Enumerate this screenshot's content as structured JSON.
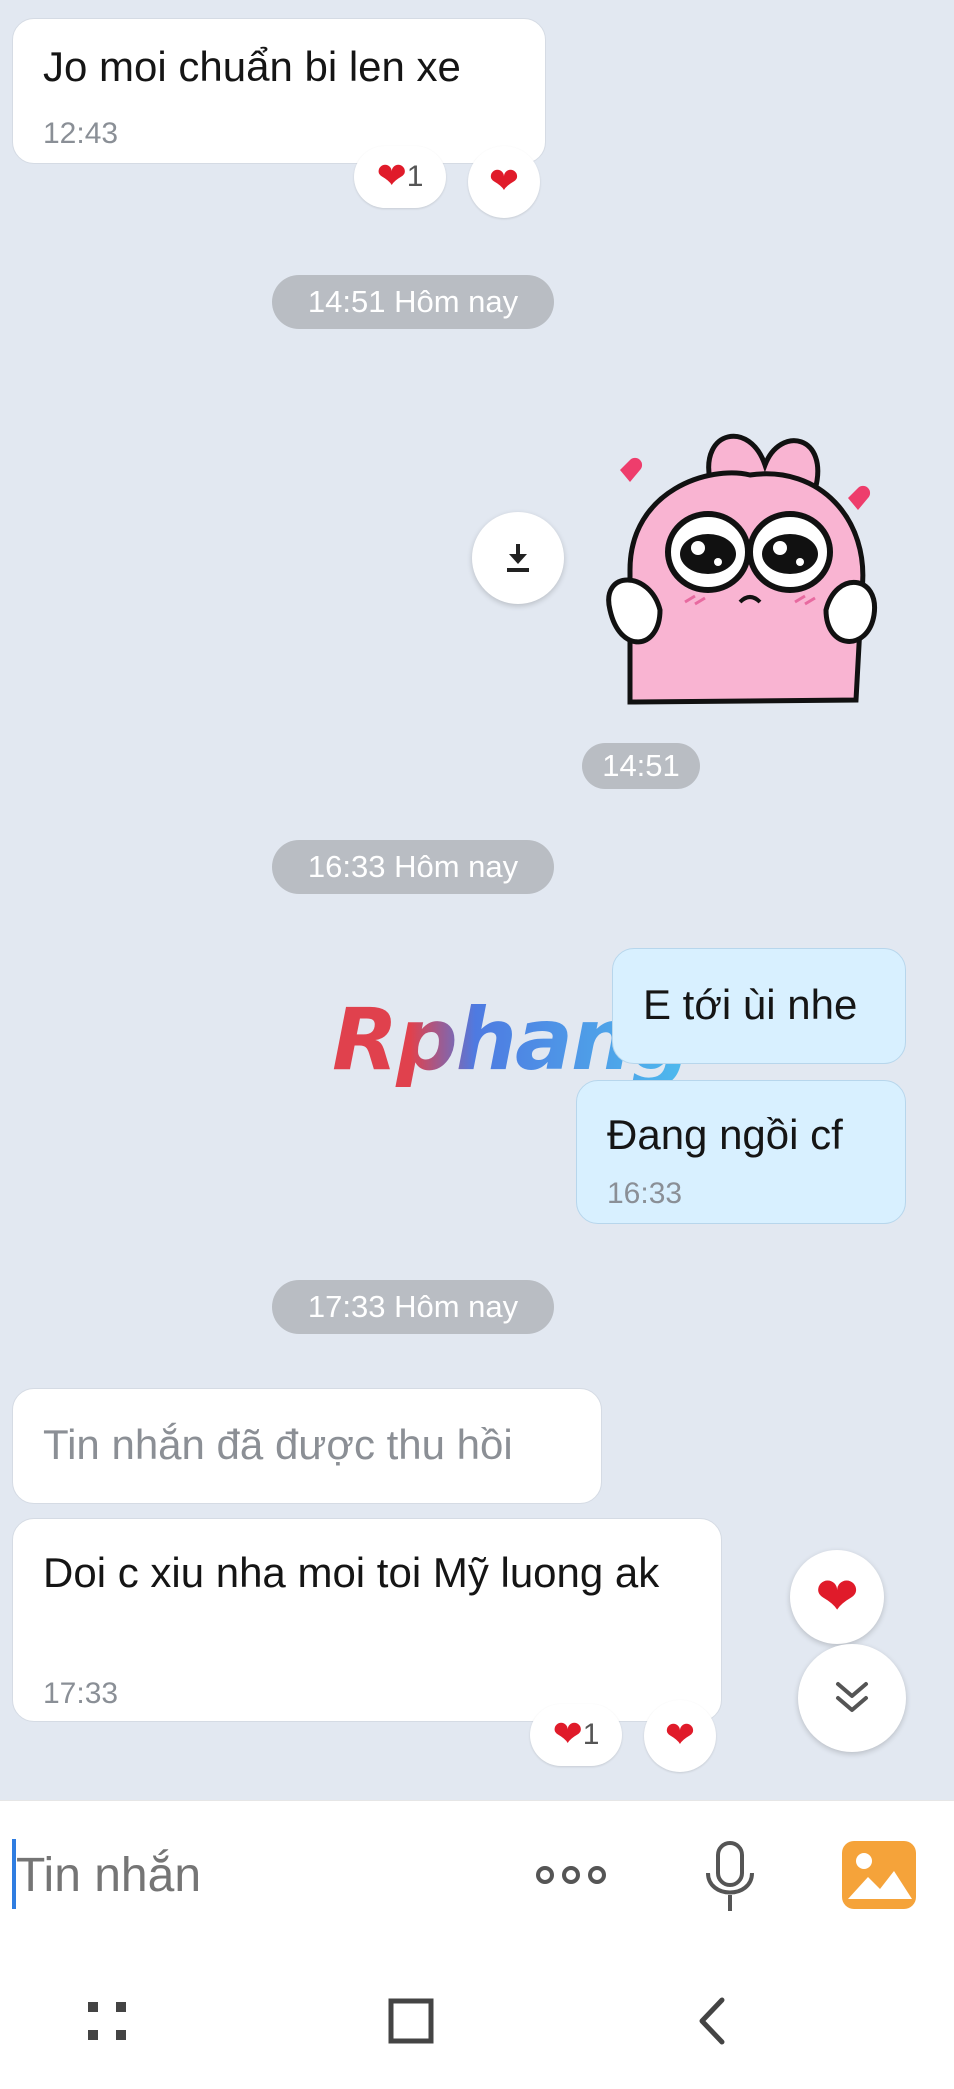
{
  "messages": {
    "m1": {
      "text": "Jo moi chuẩn bi len xe",
      "time": "12:43",
      "reaction_count": "1"
    },
    "date2": "14:51 Hôm nay",
    "sticker_time": "14:51",
    "date3": "16:33 Hôm nay",
    "m3": {
      "text": "E tới ùi nhe"
    },
    "m4": {
      "text": "Đang ngồi cf",
      "time": "16:33"
    },
    "date4": "17:33 Hôm nay",
    "m5": {
      "text": "Tin nhắn đã được thu hồi"
    },
    "m6": {
      "text": "Doi c xiu nha moi toi Mỹ luong ak",
      "time": "17:33",
      "reaction_count": "1"
    }
  },
  "watermark": "Rphang",
  "composer": {
    "placeholder": "Tin nhắn"
  },
  "icons": {
    "heart": "heart-icon",
    "download": "download-icon",
    "more": "more-options-icon",
    "mic": "microphone-icon",
    "image": "image-gallery-icon",
    "scroll_down": "double-chevron-down-icon",
    "nav_recents": "recent-apps-icon",
    "nav_home": "home-icon",
    "nav_back": "back-icon"
  },
  "colors": {
    "background": "#e2e8f1",
    "incoming_bubble": "#ffffff",
    "outgoing_bubble": "#d8f0ff",
    "heart": "#e01b2a",
    "accent_image": "#f5a33a",
    "caret": "#2f7de1"
  }
}
